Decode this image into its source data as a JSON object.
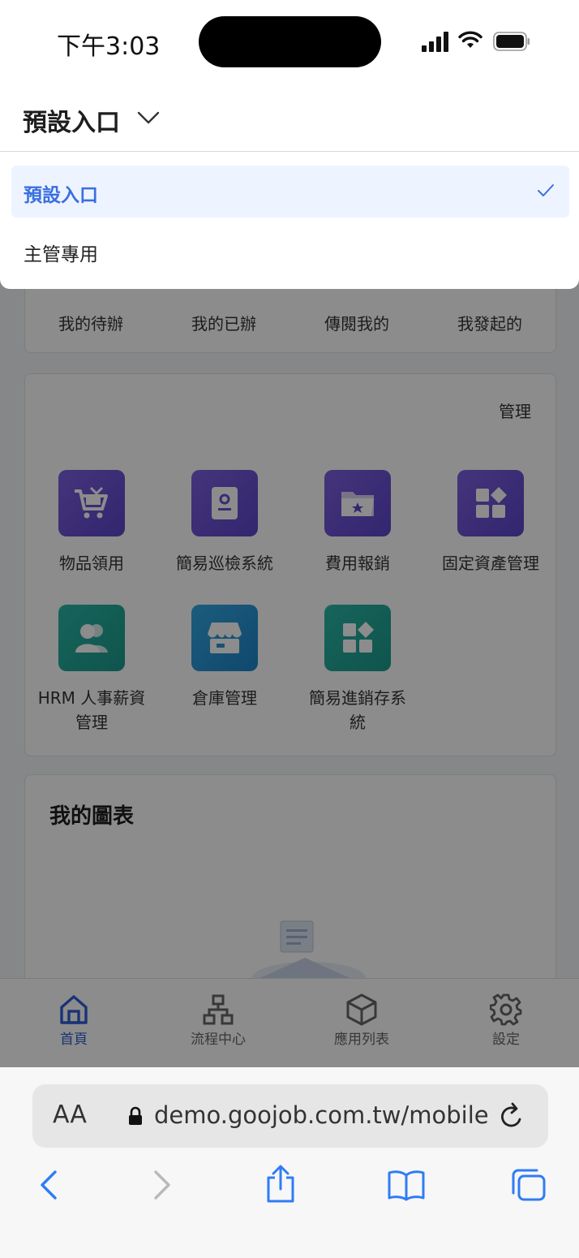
{
  "status": {
    "time": "下午3:03"
  },
  "header": {
    "title": "預設入口"
  },
  "dropdown": {
    "options": [
      {
        "label": "預設入口",
        "selected": true
      },
      {
        "label": "主管專用",
        "selected": false
      }
    ]
  },
  "quick_actions": [
    "我的待辦",
    "我的已辦",
    "傳閱我的",
    "我發起的"
  ],
  "apps": {
    "manage_label": "管理",
    "items": [
      {
        "label": "物品領用",
        "icon": "cart-icon"
      },
      {
        "label": "簡易巡檢系統",
        "icon": "id-card-icon"
      },
      {
        "label": "費用報銷",
        "icon": "folder-star-icon"
      },
      {
        "label": "固定資產管理",
        "icon": "grid-icon"
      },
      {
        "label": "HRM 人事薪資管理",
        "icon": "users-icon"
      },
      {
        "label": "倉庫管理",
        "icon": "store-icon"
      },
      {
        "label": "簡易進銷存系統",
        "icon": "grid-icon"
      }
    ]
  },
  "charts": {
    "title": "我的圖表"
  },
  "tabbar": {
    "tabs": [
      {
        "label": "首頁",
        "icon": "home-icon",
        "active": true
      },
      {
        "label": "流程中心",
        "icon": "flow-icon",
        "active": false
      },
      {
        "label": "應用列表",
        "icon": "cube-icon",
        "active": false
      },
      {
        "label": "設定",
        "icon": "gear-icon",
        "active": false
      }
    ]
  },
  "browser": {
    "text_size_label": "AA",
    "url": "demo.goojob.com.tw/mobile"
  },
  "colors": {
    "accent": "#3a6fe0",
    "purple": "#6a50d6",
    "teal": "#22a99a",
    "blue": "#2a96d6"
  }
}
